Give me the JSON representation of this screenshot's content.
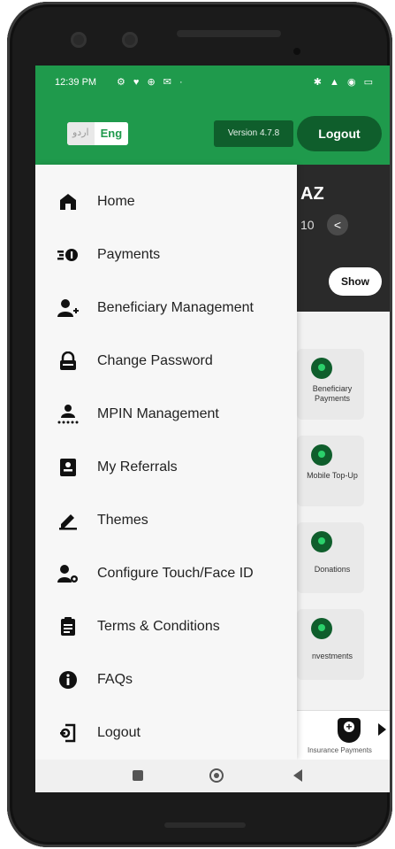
{
  "status_bar": {
    "time": "12:39 PM",
    "left_icons": "⚙ ♥ ⊕ ✉ ·",
    "right_icons": "✱ ▲ ◉ ▭"
  },
  "header": {
    "lang_urdu": "اردو",
    "lang_eng": "Eng",
    "version": "Version 4.7.8",
    "logout": "Logout"
  },
  "account": {
    "name_partial": "AZ",
    "number_partial": "10",
    "show_label": "Show"
  },
  "tiles": [
    {
      "label": "Beneficiary Payments"
    },
    {
      "label": "Mobile Top-Up"
    },
    {
      "label": "Donations"
    },
    {
      "label": "nvestments"
    }
  ],
  "bottom_bar": {
    "insurance_label": "Insurance Payments"
  },
  "drawer": {
    "items": [
      {
        "label": "Home",
        "icon": "home-icon"
      },
      {
        "label": "Payments",
        "icon": "payments-icon"
      },
      {
        "label": "Beneficiary Management",
        "icon": "beneficiary-icon"
      },
      {
        "label": "Change Password",
        "icon": "lock-icon"
      },
      {
        "label": "MPIN Management",
        "icon": "mpin-icon"
      },
      {
        "label": "My Referrals",
        "icon": "referrals-icon"
      },
      {
        "label": "Themes",
        "icon": "pen-icon"
      },
      {
        "label": "Configure Touch/Face ID",
        "icon": "user-gear-icon"
      },
      {
        "label": "Terms & Conditions",
        "icon": "clipboard-icon"
      },
      {
        "label": "FAQs",
        "icon": "info-icon"
      },
      {
        "label": "Logout",
        "icon": "logout-icon"
      }
    ]
  },
  "colors": {
    "brand_green": "#1f9a4c",
    "dark_green": "#0f5e2c",
    "drawer_bg": "#f7f7f7"
  }
}
